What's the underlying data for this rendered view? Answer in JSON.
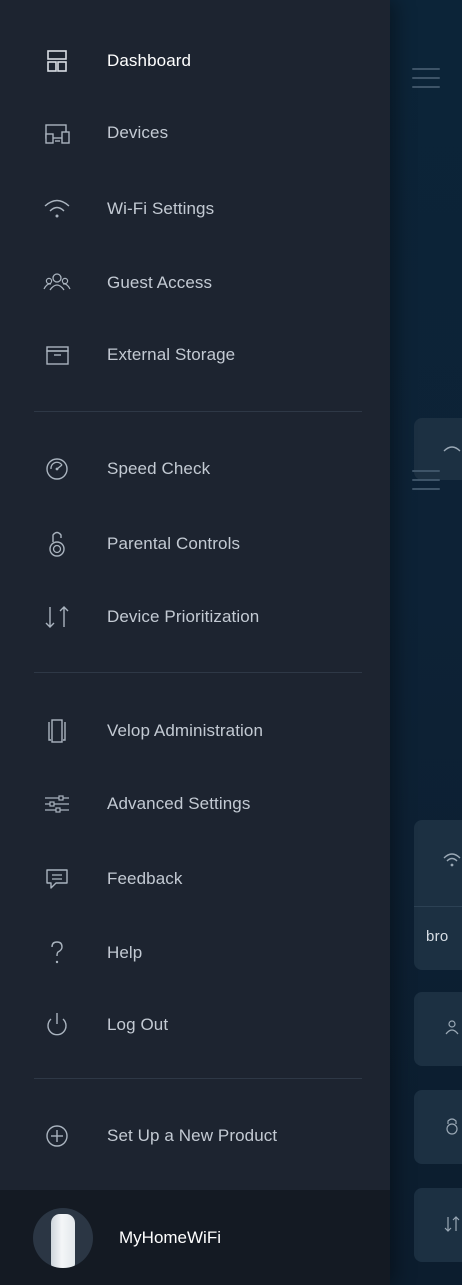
{
  "background_app": {
    "card_text": "bro"
  },
  "menu": {
    "group1": [
      {
        "label": "Dashboard",
        "icon": "dashboard-icon",
        "active": true
      },
      {
        "label": "Devices",
        "icon": "devices-icon"
      },
      {
        "label": "Wi-Fi Settings",
        "icon": "wifi-icon"
      },
      {
        "label": "Guest Access",
        "icon": "guest-access-icon"
      },
      {
        "label": "External Storage",
        "icon": "storage-box-icon"
      }
    ],
    "group2": [
      {
        "label": "Speed Check",
        "icon": "speedometer-icon"
      },
      {
        "label": "Parental Controls",
        "icon": "padlock-icon"
      },
      {
        "label": "Device Prioritization",
        "icon": "priority-arrows-icon"
      }
    ],
    "group3": [
      {
        "label": "Velop Administration",
        "icon": "velop-node-icon"
      },
      {
        "label": "Advanced Settings",
        "icon": "sliders-icon"
      },
      {
        "label": "Feedback",
        "icon": "speech-bubble-icon"
      },
      {
        "label": "Help",
        "icon": "question-mark-icon"
      },
      {
        "label": "Log Out",
        "icon": "power-icon"
      }
    ],
    "group4": [
      {
        "label": "Set Up a New Product",
        "icon": "plus-circle-icon"
      }
    ]
  },
  "footer": {
    "network_name": "MyHomeWiFi"
  },
  "colors": {
    "drawer_bg": "#1d2430",
    "footer_bg": "#141a23",
    "background_app": "#0c2438",
    "label_text": "#c3cad3",
    "active_label_text": "#ffffff",
    "icon_stroke": "#aab4bf"
  }
}
